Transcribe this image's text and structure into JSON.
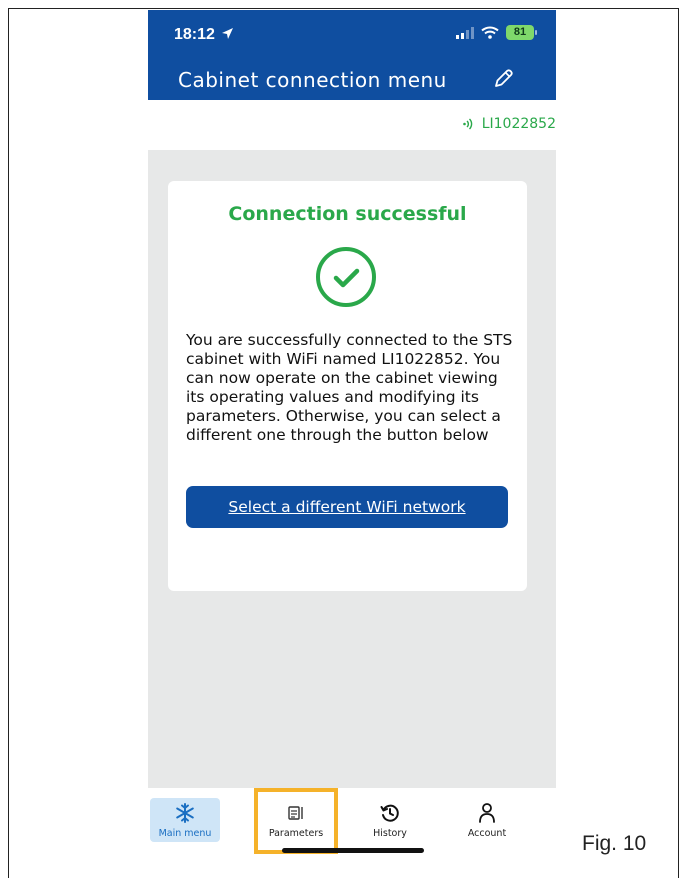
{
  "status_bar": {
    "time": "18:12",
    "battery": "81"
  },
  "header": {
    "title": "Cabinet connection menu"
  },
  "device": {
    "id": "LI1022852"
  },
  "card": {
    "title": "Connection successful",
    "body": "You are successfully connected to the STS cabinet with WiFi named LI1022852. You can now operate on the cabinet viewing its operating values and modifying its parameters. Otherwise, you can select a different one through the button below",
    "button_label": "Select a different WiFi network"
  },
  "tabs": [
    {
      "label": "Main menu",
      "icon": "snowflake-icon",
      "active": true
    },
    {
      "label": "Parameters",
      "icon": "parameters-icon",
      "active": false
    },
    {
      "label": "History",
      "icon": "history-icon",
      "active": false
    },
    {
      "label": "Account",
      "icon": "account-icon",
      "active": false
    }
  ],
  "figure_label": "Fig. 10",
  "colors": {
    "brand_blue": "#0f4ea0",
    "success_green": "#2aa84a",
    "highlight_orange": "#f5b22a",
    "active_tab_bg": "#cfe5f7"
  }
}
